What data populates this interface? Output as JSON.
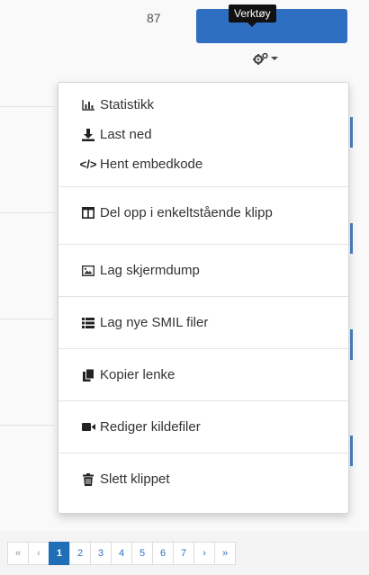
{
  "header": {
    "count": "87",
    "tooltip": "Verktøy"
  },
  "menu": {
    "items": [
      {
        "label": "Statistikk",
        "icon": "bar-chart-icon"
      },
      {
        "label": "Last ned",
        "icon": "download-icon"
      },
      {
        "label": "Hent embedkode",
        "icon": "code-icon",
        "glyph": "</>"
      },
      {
        "label": "Del opp i enkeltstående klipp",
        "icon": "columns-icon"
      },
      {
        "label": "Lag skjermdump",
        "icon": "image-icon"
      },
      {
        "label": "Lag nye SMIL filer",
        "icon": "list-icon"
      },
      {
        "label": "Kopier lenke",
        "icon": "copy-icon"
      },
      {
        "label": "Rediger kildefiler",
        "icon": "video-camera-icon"
      },
      {
        "label": "Slett klippet",
        "icon": "trash-icon"
      }
    ]
  },
  "pagination": {
    "first": "«",
    "prev": "‹",
    "pages": [
      "1",
      "2",
      "3",
      "4",
      "5",
      "6",
      "7"
    ],
    "active_page": "1",
    "next": "›",
    "last": "»"
  },
  "colors": {
    "accent": "#2f6fc1",
    "active_page": "#1f6fb8"
  }
}
